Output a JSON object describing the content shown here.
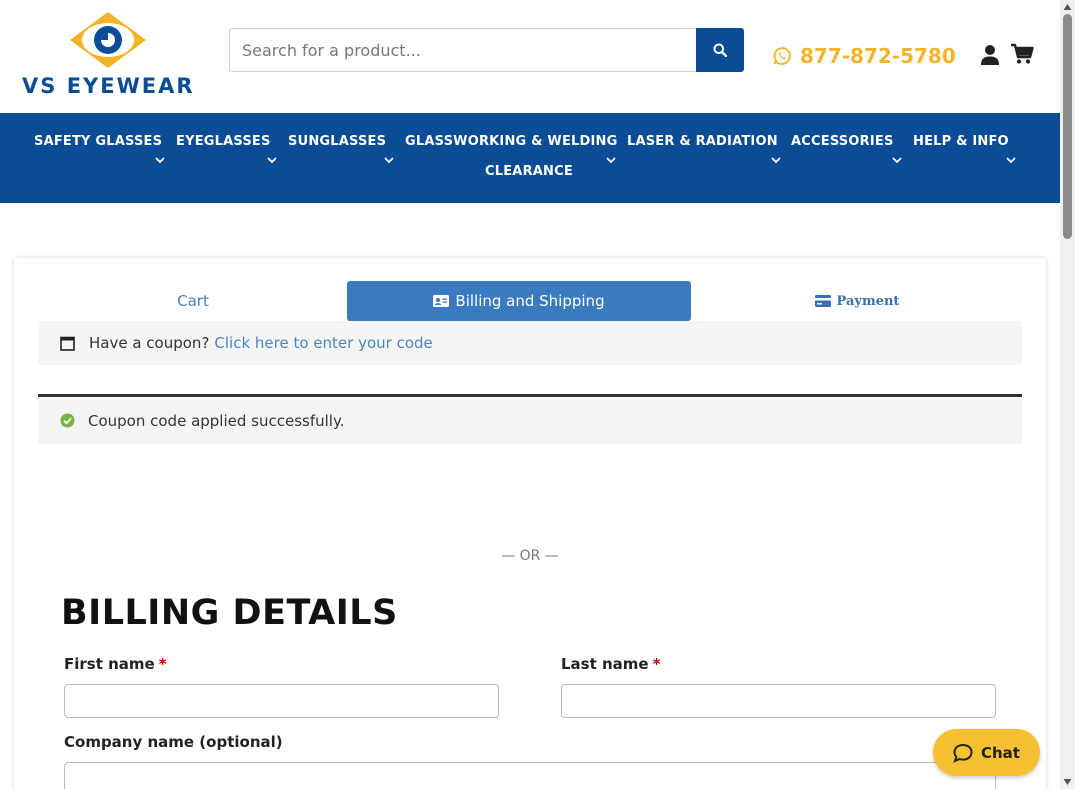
{
  "header": {
    "logo_text": "VS EYEWEAR",
    "search_placeholder": "Search for a product...",
    "phone": "877-872-5780"
  },
  "nav": {
    "items": [
      {
        "label": "SAFETY GLASSES"
      },
      {
        "label": "EYEGLASSES"
      },
      {
        "label": "SUNGLASSES"
      },
      {
        "label": "GLASSWORKING & WELDING"
      },
      {
        "label": "LASER & RADIATION"
      },
      {
        "label": "ACCESSORIES"
      },
      {
        "label": "HELP & INFO"
      },
      {
        "label": "CLEARANCE"
      }
    ]
  },
  "checkout": {
    "steps": [
      {
        "label": "Cart"
      },
      {
        "label": "Billing and Shipping"
      },
      {
        "label": "Payment"
      }
    ],
    "active_step": "Billing and Shipping",
    "coupon_prompt": "Have a coupon?",
    "coupon_link": "Click here to enter your code",
    "success_message": "Coupon code applied successfully.",
    "or_separator": "— OR —",
    "billing_title": "BILLING DETAILS",
    "fields": {
      "first_name": {
        "label": "First name",
        "required_mark": "*",
        "value": ""
      },
      "last_name": {
        "label": "Last name",
        "required_mark": "*",
        "value": ""
      },
      "company": {
        "label": "Company name (optional)",
        "value": ""
      }
    }
  },
  "chat": {
    "label": "Chat"
  },
  "colors": {
    "brand_blue": "#0a4c96",
    "brand_yellow": "#f4b42a",
    "step_active": "#3a7abf",
    "link": "#4a86c5",
    "success": "#7cb342",
    "chat_bg": "#f6c131"
  }
}
